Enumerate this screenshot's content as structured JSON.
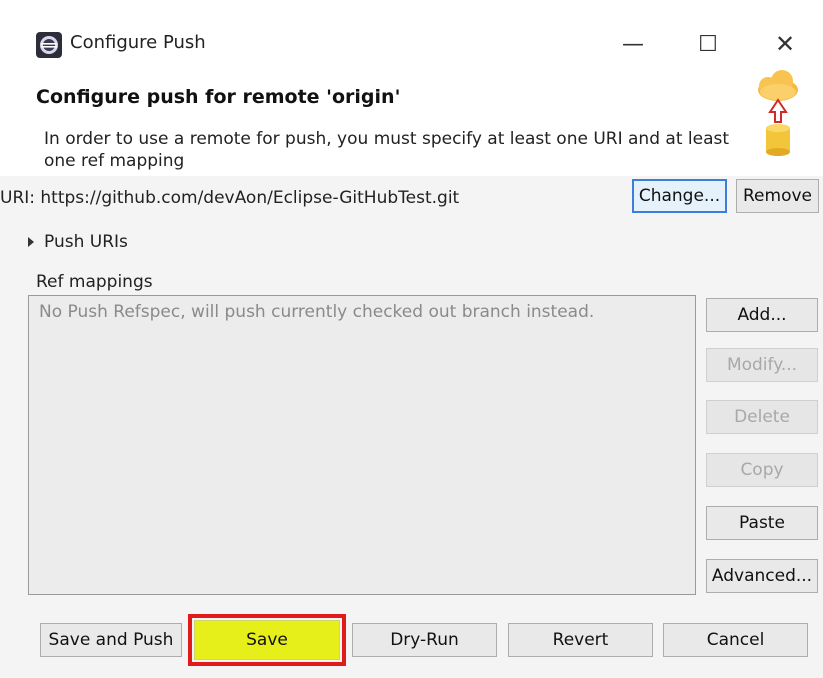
{
  "window": {
    "title": "Configure Push",
    "controls": {
      "minimize": "—",
      "maximize": "☐",
      "close": "✕"
    }
  },
  "header": {
    "title": "Configure push for remote 'origin'",
    "description": "In order to use a remote for push, you must specify at least one URI and at least one ref mapping"
  },
  "uri": {
    "label": "URI:  https://github.com/devAon/Eclipse-GitHubTest.git",
    "change_button": "Change...",
    "remove_button": "Remove"
  },
  "push_uris": {
    "label": "Push URIs"
  },
  "ref_mappings": {
    "label": "Ref mappings",
    "empty_message": "No Push Refspec, will push currently checked out branch instead.",
    "buttons": {
      "add": "Add...",
      "modify": "Modify...",
      "delete": "Delete",
      "copy": "Copy",
      "paste": "Paste",
      "advanced": "Advanced..."
    }
  },
  "footer": {
    "save_and_push": "Save and Push",
    "save": "Save",
    "dry_run": "Dry-Run",
    "revert": "Revert",
    "cancel": "Cancel"
  },
  "colors": {
    "highlight_border": "#e11a1a",
    "save_highlight": "#e6ef1a",
    "focus_border": "#3c7fd6"
  },
  "icons": {
    "app": "eclipse-icon",
    "banner": "cloud-upload-database-icon"
  }
}
